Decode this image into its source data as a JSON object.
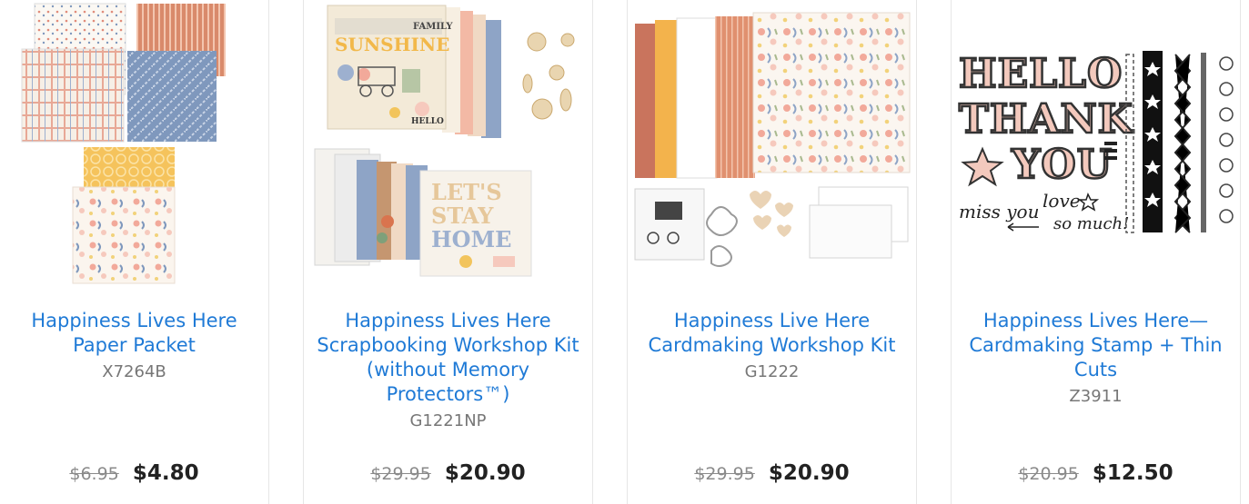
{
  "products": [
    {
      "title": "Happiness Lives Here Paper Packet",
      "sku": "X7264B",
      "old_price": "$6.95",
      "price": "$4.80",
      "image": "paper-packet-image"
    },
    {
      "title": "Happiness Lives Here Scrapbooking Workshop Kit (without Memory Protectors™)",
      "sku": "G1221NP",
      "old_price": "$29.95",
      "price": "$20.90",
      "image": "scrapbooking-kit-image"
    },
    {
      "title": "Happiness Live Here Cardmaking Workshop Kit",
      "sku": "G1222",
      "old_price": "$29.95",
      "price": "$20.90",
      "image": "cardmaking-kit-image"
    },
    {
      "title": "Happiness Lives Here—Cardmaking Stamp + Thin Cuts",
      "sku": "Z3911",
      "old_price": "$20.95",
      "price": "$12.50",
      "image": "stamp-set-image"
    }
  ],
  "image_text": {
    "family": "FAMILY",
    "sunshine": "SUNSHINE",
    "hello_small": "HELLO",
    "lets": "LET'S",
    "stay": "STAY",
    "home": "HOME",
    "hello": "HELLO",
    "thank": "THANK",
    "you": "YOU",
    "miss_you": "miss you",
    "love": "love",
    "so_much": "so much!"
  },
  "colors": {
    "link": "#1f7ad6",
    "price": "#222222",
    "old_price": "#8a8a8a",
    "sku": "#777777",
    "coral": "#d98a6b",
    "denim": "#7f98bd",
    "mustard": "#f2c45c",
    "blush": "#f6c9bd"
  }
}
